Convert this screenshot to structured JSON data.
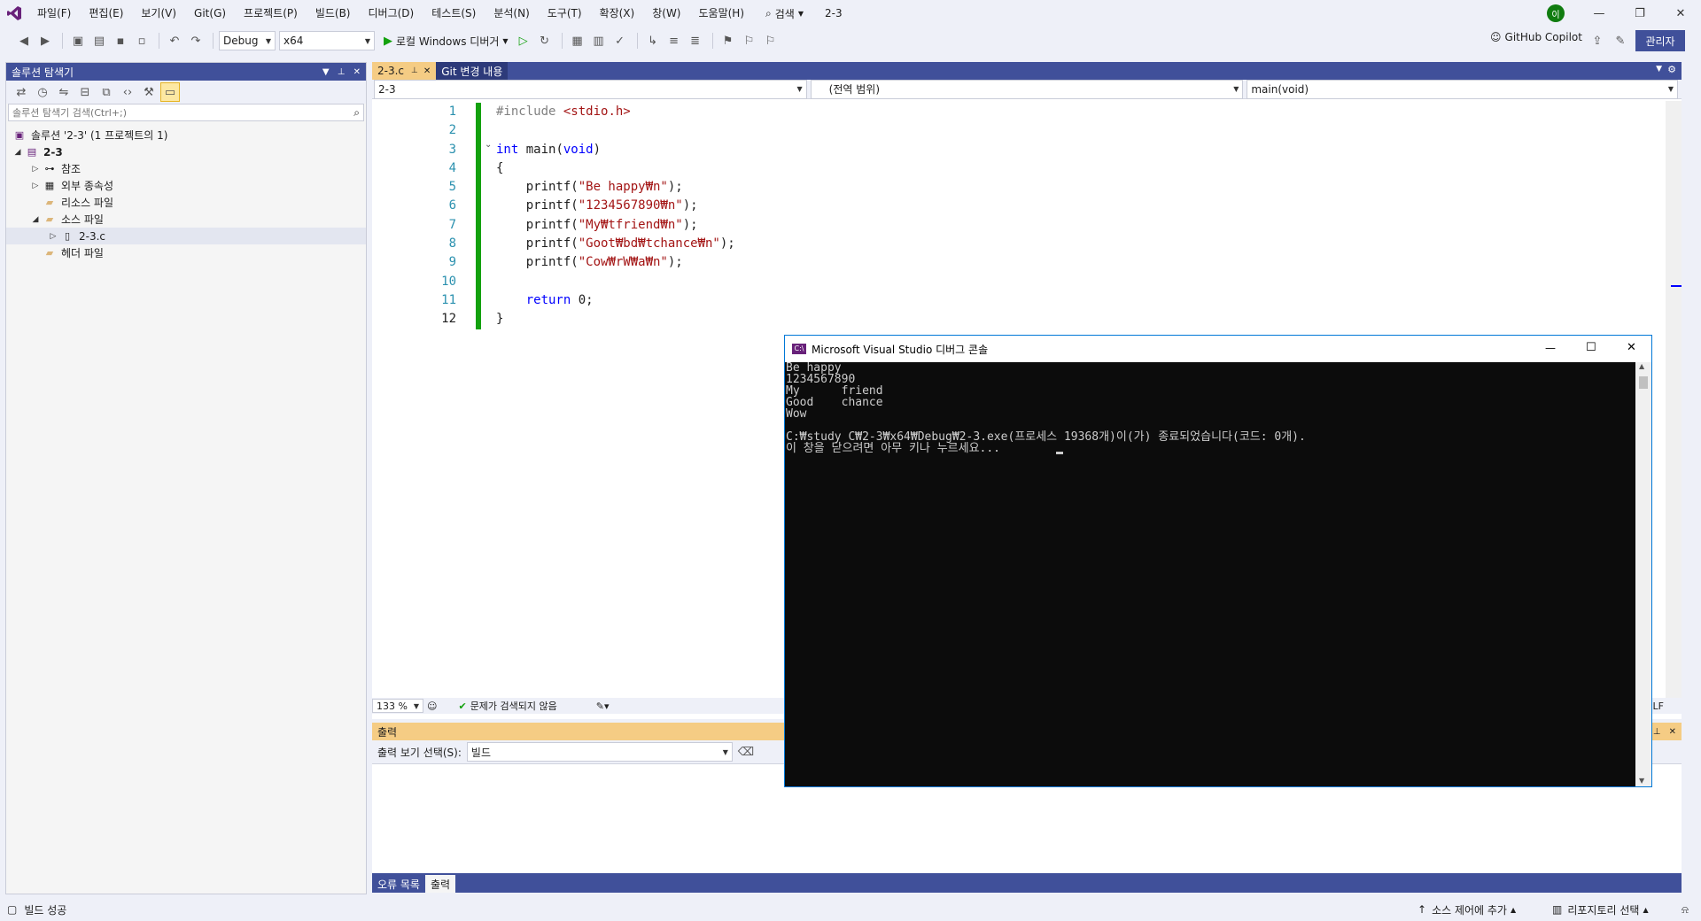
{
  "menubar": {
    "items": [
      "파일(F)",
      "편집(E)",
      "보기(V)",
      "Git(G)",
      "프로젝트(P)",
      "빌드(B)",
      "디버그(D)",
      "테스트(S)",
      "분석(N)",
      "도구(T)",
      "확장(X)",
      "창(W)",
      "도움말(H)"
    ],
    "search_label": "검색",
    "solution_name": "2-3",
    "avatar_initial": "이",
    "admin_label": "관리자"
  },
  "toolbar": {
    "config": "Debug",
    "platform": "x64",
    "run_label": "로컬 Windows 디버거",
    "copilot_label": "GitHub Copilot"
  },
  "solution_explorer": {
    "title": "솔루션 탐색기",
    "search_placeholder": "솔루션 탐색기 검색(Ctrl+;)",
    "tree": [
      {
        "label": "솔루션 '2-3' (1 프로젝트의 1)",
        "icon": "solution-icon"
      },
      {
        "label": "2-3",
        "icon": "project-icon"
      },
      {
        "label": "참조",
        "icon": "references-icon"
      },
      {
        "label": "외부 종속성",
        "icon": "dependencies-icon"
      },
      {
        "label": "리소스 파일",
        "icon": "folder-icon"
      },
      {
        "label": "소스 파일",
        "icon": "folder-icon"
      },
      {
        "label": "2-3.c",
        "icon": "c-file-icon"
      },
      {
        "label": "헤더 파일",
        "icon": "folder-icon"
      }
    ]
  },
  "editor": {
    "tabs": [
      {
        "label": "2-3.c",
        "active": true
      },
      {
        "label": "Git 변경 내용",
        "active": false
      }
    ],
    "nav": {
      "project": "2-3",
      "scope": "(전역 범위)",
      "member": "main(void)"
    },
    "lines": [
      {
        "n": "1",
        "text": "#include <stdio.h>"
      },
      {
        "n": "2",
        "text": ""
      },
      {
        "n": "3",
        "text": "int main(void)"
      },
      {
        "n": "4",
        "text": "{"
      },
      {
        "n": "5",
        "text": "    printf(\"Be happy₩n\");"
      },
      {
        "n": "6",
        "text": "    printf(\"1234567890₩n\");"
      },
      {
        "n": "7",
        "text": "    printf(\"My₩tfriend₩n\");"
      },
      {
        "n": "8",
        "text": "    printf(\"Goot₩bd₩tchance₩n\");"
      },
      {
        "n": "9",
        "text": "    printf(\"Cow₩rW₩a₩n\");"
      },
      {
        "n": "10",
        "text": ""
      },
      {
        "n": "11",
        "text": "    return 0;"
      },
      {
        "n": "12",
        "text": "}"
      }
    ],
    "zoom": "133 %",
    "issues": "문제가 검색되지 않음",
    "line_ending": "CRLF"
  },
  "console": {
    "title": "Microsoft Visual Studio 디버그 콘솔",
    "lines": [
      "Be happy",
      "1234567890",
      "My      friend",
      "Good    chance",
      "Wow",
      "",
      "C:₩study C₩2-3₩x64₩Debug₩2-3.exe(프로세스 19368개)이(가) 종료되었습니다(코드: 0개).",
      "이 창을 닫으려면 아무 키나 누르세요..."
    ]
  },
  "output": {
    "title": "출력",
    "source_label": "출력 보기 선택(S):",
    "source_value": "빌드",
    "bottom_tabs": [
      "오류 목록",
      "출력"
    ]
  },
  "statusbar": {
    "status": "빌드 성공",
    "source_control": "소스 제어에 추가",
    "repository": "리포지토리 선택"
  },
  "colors": {
    "accent": "#40509a",
    "purple": "#68217a",
    "console_bg": "#0c0c0c",
    "change_bar": "#13a10e"
  }
}
